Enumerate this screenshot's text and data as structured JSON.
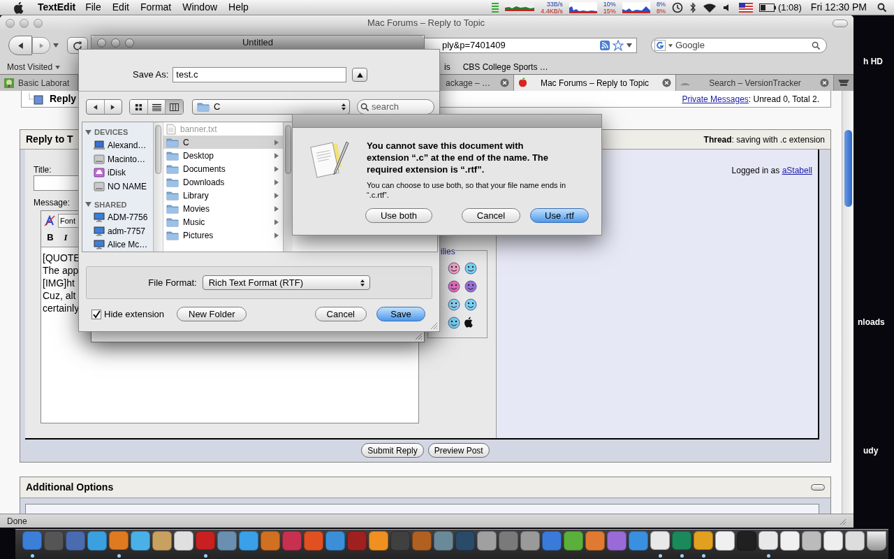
{
  "menu_bar": {
    "app_name": "TextEdit",
    "menus": [
      "File",
      "Edit",
      "Format",
      "Window",
      "Help"
    ],
    "network": [
      "33B/s",
      "4.4KB/s"
    ],
    "cpu": [
      "10%",
      "15%"
    ],
    "memory": [
      "8%",
      "8%"
    ],
    "battery": "(1:08)",
    "clock": "Fri 12:30 PM"
  },
  "desktop_labels": [
    "h HD",
    "nloads",
    "udy"
  ],
  "browser": {
    "title": "Mac Forums – Reply to Topic",
    "url": "ply&p=7401409",
    "search_placeholder": "Google",
    "bookmarks": [
      "Most Visited",
      "is",
      "CBS College Sports …"
    ],
    "tabs": [
      {
        "label": "Basic Laborat",
        "selected": false
      },
      {
        "label": "ackage – …",
        "selected": false
      },
      {
        "label": "Mac Forums – Reply to Topic",
        "selected": true
      },
      {
        "label": "Search – VersionTracker",
        "selected": false
      }
    ],
    "status": "Done"
  },
  "forum": {
    "heading": "Reply",
    "private_messages_link": "Private Messages",
    "private_messages_text": ": Unread 0, Total 2.",
    "panel_title": "Reply to T",
    "thread": "**Thread**: saving with .c extension",
    "title_label": "Title:",
    "message_label": "Message:",
    "font_menu": "Font",
    "format_buttons": [
      "B",
      "I"
    ],
    "message_lines": [
      "[QUOTE",
      "The app",
      "[IMG]ht",
      "Cuz, alt",
      "certainly"
    ],
    "smilies_label": "ilies",
    "logged_in": "Logged in as ",
    "user": "aStabell",
    "buttons": [
      "Submit Reply",
      "Preview Post"
    ],
    "options_title": "Additional Options"
  },
  "save_dialog": {
    "window_title": "Untitled",
    "save_as_label": "Save As:",
    "filename": "test.c",
    "location": "C",
    "search_placeholder": "search",
    "view_modes": [
      {
        "selected": false
      },
      {
        "selected": false
      },
      {
        "selected": true
      }
    ],
    "sidebar": [
      {
        "title": "DEVICES",
        "expanded": true,
        "items": [
          {
            "label": "Alexand…",
            "kind": "laptop"
          },
          {
            "label": "Macinto…",
            "kind": "drive"
          },
          {
            "label": "iDisk",
            "kind": "idisk"
          },
          {
            "label": "NO NAME",
            "kind": "drive"
          }
        ]
      },
      {
        "title": "SHARED",
        "expanded": true,
        "items": [
          {
            "label": "ADM-7756",
            "kind": "computer"
          },
          {
            "label": "adm-7757",
            "kind": "computer"
          },
          {
            "label": "Alice Mc…",
            "kind": "computer"
          }
        ]
      }
    ],
    "files": [
      {
        "name": "banner.txt",
        "kind": "file",
        "selected": false,
        "disabled": true
      },
      {
        "name": "C",
        "kind": "folder",
        "selected": true,
        "disabled": false
      },
      {
        "name": "Desktop",
        "kind": "folder",
        "selected": false,
        "disabled": false
      },
      {
        "name": "Documents",
        "kind": "folder",
        "selected": false,
        "disabled": false
      },
      {
        "name": "Downloads",
        "kind": "folder",
        "selected": false,
        "disabled": false
      },
      {
        "name": "Library",
        "kind": "folder",
        "selected": false,
        "disabled": false
      },
      {
        "name": "Movies",
        "kind": "folder",
        "selected": false,
        "disabled": false
      },
      {
        "name": "Music",
        "kind": "folder",
        "selected": false,
        "disabled": false
      },
      {
        "name": "Pictures",
        "kind": "folder",
        "selected": false,
        "disabled": false
      }
    ],
    "file_format_label": "File Format:",
    "file_format": "Rich Text Format (RTF)",
    "hide_extension": {
      "label": "Hide extension",
      "checked": true
    },
    "buttons": [
      {
        "label": "New Folder",
        "kind": "normal"
      },
      {
        "label": "Cancel",
        "kind": "normal"
      },
      {
        "label": "Save",
        "kind": "default"
      }
    ]
  },
  "alert": {
    "message": "You cannot save this document with extension “.c” at the end of the name. The required extension is “.rtf”.",
    "info": "You can choose to use both, so that your file name ends in “.c.rtf”.",
    "buttons": [
      {
        "label": "Use both",
        "kind": "normal"
      },
      {
        "label": "Cancel",
        "kind": "normal"
      },
      {
        "label": "Use .rtf",
        "kind": "default"
      }
    ]
  },
  "dock": [
    {
      "running": true
    },
    {
      "running": false
    },
    {
      "running": false
    },
    {
      "running": false
    },
    {
      "running": true
    },
    {
      "running": false
    },
    {
      "running": false
    },
    {
      "running": false
    },
    {
      "running": true
    },
    {
      "running": false
    },
    {
      "running": false
    },
    {
      "running": false
    },
    {
      "running": false
    },
    {
      "running": false
    },
    {
      "running": false
    },
    {
      "running": false
    },
    {
      "running": false
    },
    {
      "running": false
    },
    {
      "running": false
    },
    {
      "running": false
    },
    {
      "running": false
    },
    {
      "running": false
    },
    {
      "running": false
    },
    {
      "running": false
    },
    {
      "running": false
    },
    {
      "running": false
    },
    {
      "running": false
    },
    {
      "running": false
    },
    {
      "running": false
    },
    {
      "running": true
    },
    {
      "running": true
    },
    {
      "running": true
    },
    {
      "running": false
    },
    {
      "running": false
    },
    {
      "running": true
    },
    {
      "running": false
    },
    {
      "running": false
    },
    {
      "running": false
    },
    {
      "running": false
    },
    {
      "running": false
    }
  ]
}
